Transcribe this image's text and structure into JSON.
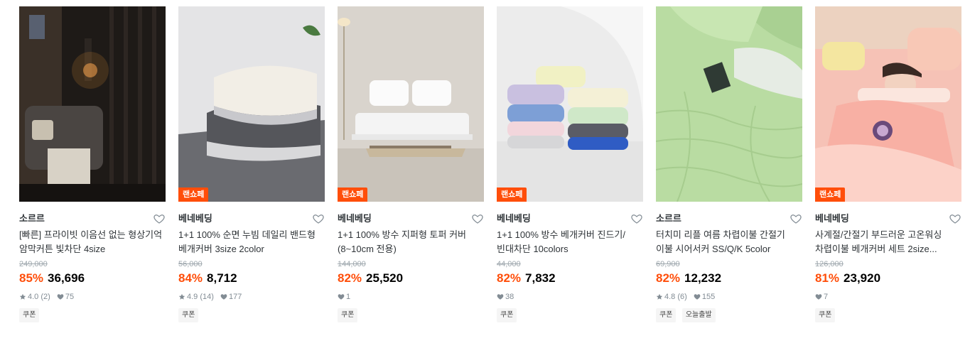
{
  "products": [
    {
      "brand": "소르르",
      "title": "[빠른] 프라이빗 이음선 없는 형상기억 암막커튼 빛차단 4size",
      "original_price": "249,000",
      "discount": "85%",
      "price": "36,696",
      "rating": "4.0",
      "review_count": "(2)",
      "likes": "75",
      "tags": [
        "쿠폰"
      ],
      "image_icon": "dark-room-curtain-photo"
    },
    {
      "brand": "베네베딩",
      "live_badge": "랜쇼페",
      "title": "1+1 100% 순면 누빔 데일리 밴드형 베개커버 3size 2color",
      "original_price": "56,000",
      "discount": "84%",
      "price": "8,712",
      "rating": "4.9",
      "review_count": "(14)",
      "likes": "177",
      "tags": [
        "쿠폰"
      ],
      "image_icon": "stacked-pillows-photo"
    },
    {
      "brand": "베네베딩",
      "live_badge": "랜쇼페",
      "title": "1+1 100% 방수 지퍼형 토퍼 커버 (8~10cm 전용)",
      "original_price": "144,000",
      "discount": "82%",
      "price": "25,520",
      "likes": "1",
      "tags": [
        "쿠폰"
      ],
      "image_icon": "bed-topper-photo"
    },
    {
      "brand": "베네베딩",
      "live_badge": "랜쇼페",
      "title": "1+1 100% 방수 베개커버 진드기/빈대차단 10colors",
      "original_price": "44,000",
      "discount": "82%",
      "price": "7,832",
      "likes": "38",
      "tags": [
        "쿠폰"
      ],
      "image_icon": "colorful-pillows-photo"
    },
    {
      "brand": "소르르",
      "title": "터치미 리플 여름 차렵이불 간절기 이불 시어서커 SS/Q/K 5color",
      "original_price": "69,900",
      "discount": "82%",
      "price": "12,232",
      "rating": "4.8",
      "review_count": "(6)",
      "likes": "155",
      "tags": [
        "쿠폰",
        "오늘출발"
      ],
      "image_icon": "green-blanket-photo"
    },
    {
      "brand": "베네베딩",
      "live_badge": "랜쇼페",
      "title": "사계절/간절기 부드러운 고온워싱 차렵이불 베개커버 세트 2size...",
      "original_price": "126,000",
      "discount": "81%",
      "price": "23,920",
      "likes": "7",
      "tags": [
        "쿠폰"
      ],
      "image_icon": "pink-bedding-photo"
    }
  ],
  "colors": {
    "accent": "#ff4e0a",
    "muted": "#828c94",
    "strike": "#9ea7ad"
  }
}
